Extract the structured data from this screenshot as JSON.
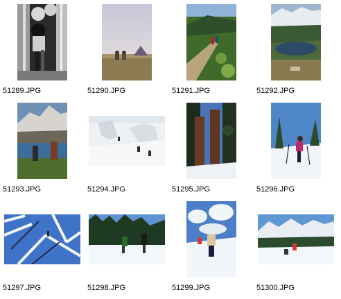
{
  "files": [
    {
      "name": "51289.JPG",
      "subject": "hiker-in-forest-bw"
    },
    {
      "name": "51290.JPG",
      "subject": "campsite-tent-dusk"
    },
    {
      "name": "51291.JPG",
      "subject": "hikers-mountain-trail"
    },
    {
      "name": "51292.JPG",
      "subject": "mountain-lake-campers"
    },
    {
      "name": "51293.JPG",
      "subject": "hikers-by-alpine-lake"
    },
    {
      "name": "51294.JPG",
      "subject": "skiers-on-snow-slope"
    },
    {
      "name": "51295.JPG",
      "subject": "giant-trees-in-snow"
    },
    {
      "name": "51296.JPG",
      "subject": "cross-country-skier"
    },
    {
      "name": "51297.JPG",
      "subject": "skier-under-snowy-branches"
    },
    {
      "name": "51298.JPG",
      "subject": "two-skiers-pine-forest"
    },
    {
      "name": "51299.JPG",
      "subject": "skiers-blue-sky-clouds"
    },
    {
      "name": "51300.JPG",
      "subject": "skiers-mountain-valley"
    }
  ]
}
